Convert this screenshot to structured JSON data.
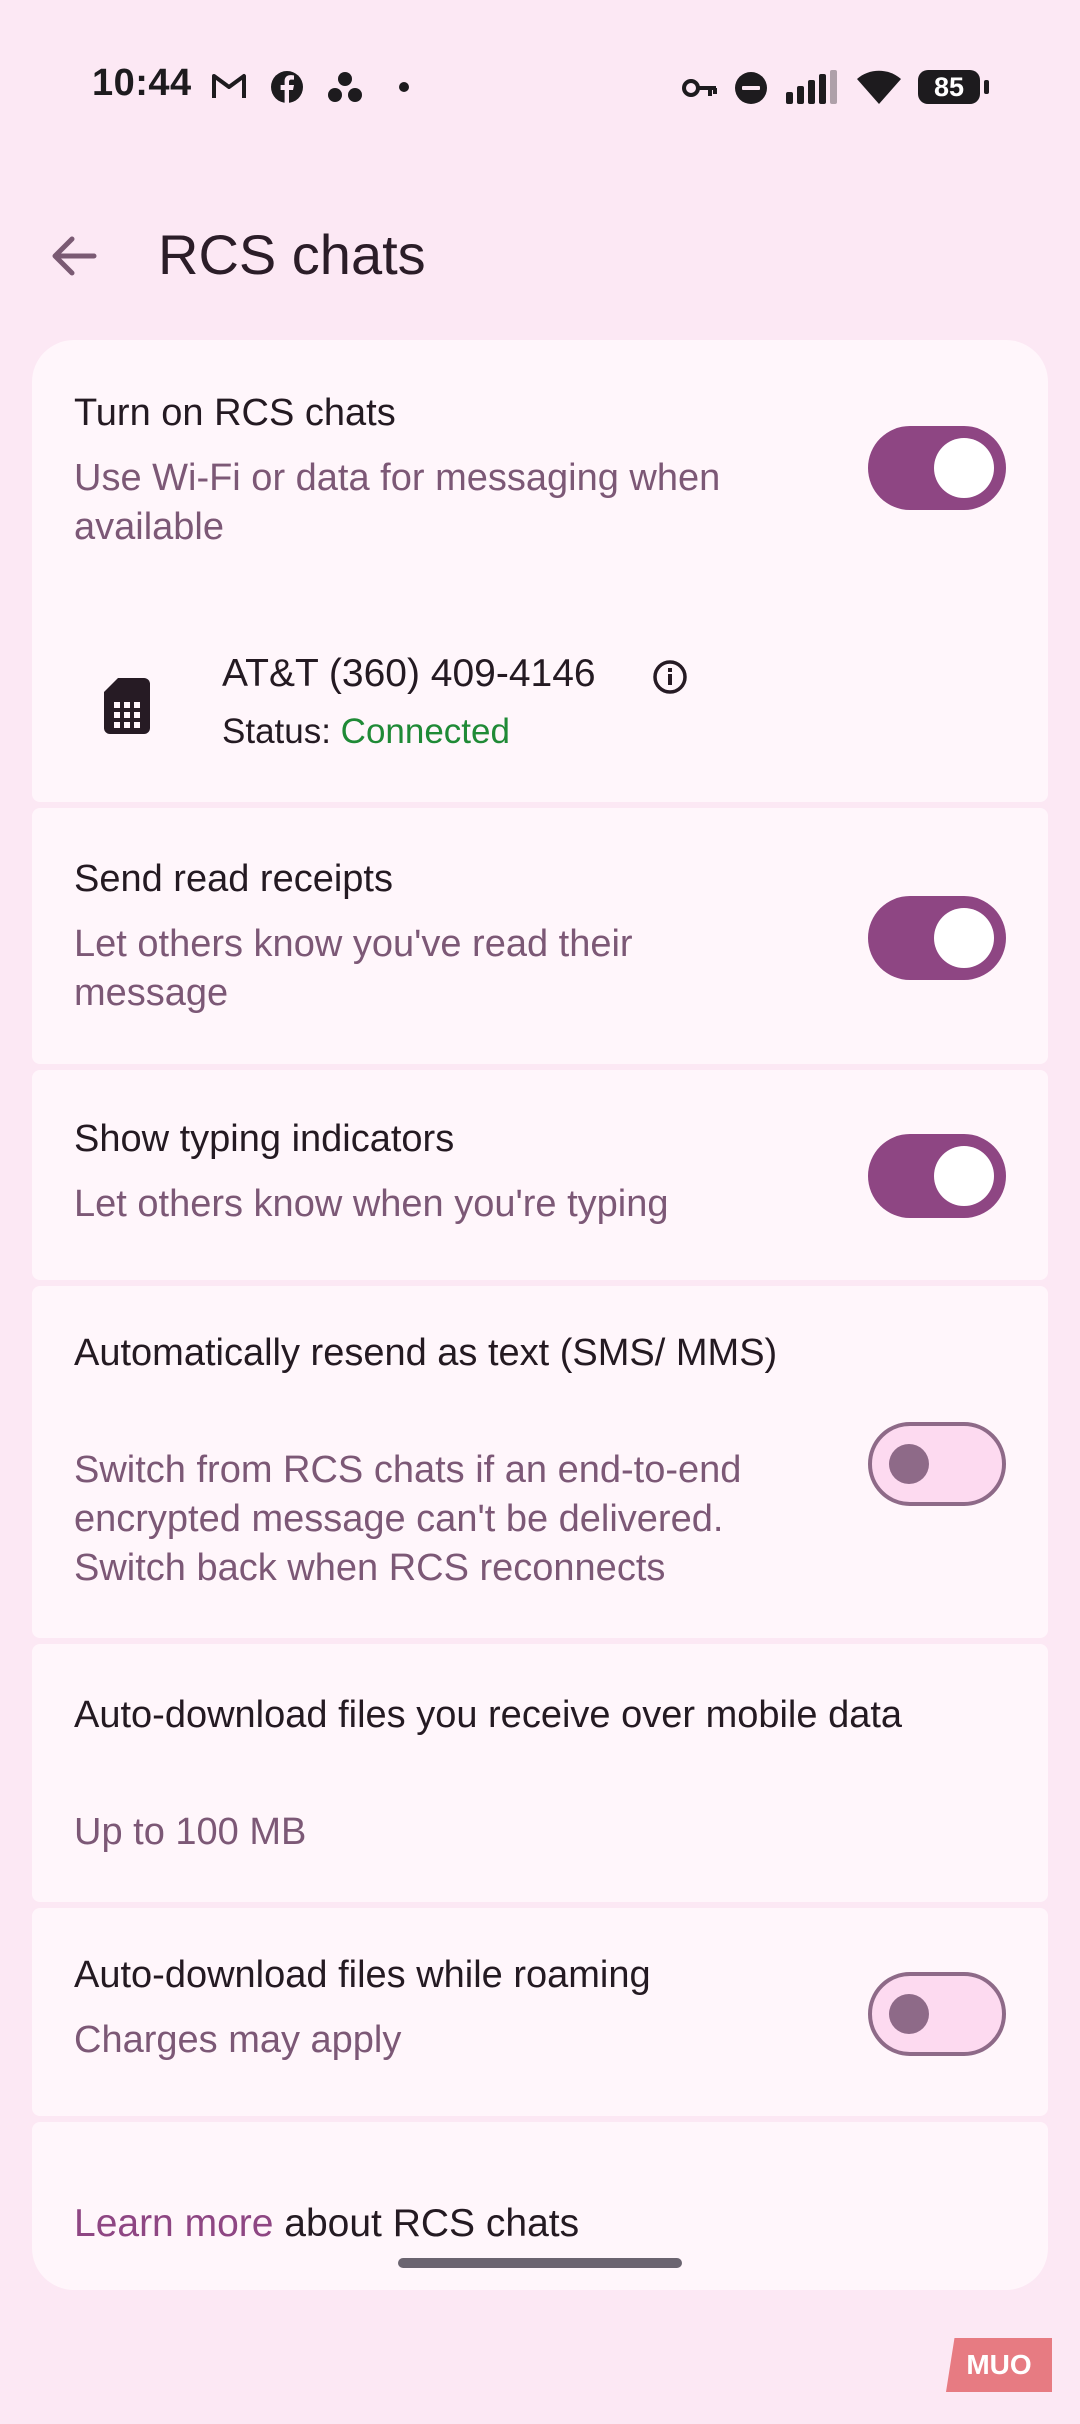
{
  "status_bar": {
    "time": "10:44",
    "battery": "85",
    "notification_icons": [
      "gmail-icon",
      "facebook-icon",
      "dots-icon",
      "dot-icon"
    ],
    "system_icons": [
      "vpn-key-icon",
      "dnd-icon",
      "signal-icon",
      "wifi-icon",
      "battery-icon"
    ]
  },
  "app_bar": {
    "title": "RCS chats",
    "back_icon": "arrow-back-icon"
  },
  "settings": {
    "rcs": {
      "title": "Turn on RCS chats",
      "subtitle": "Use Wi-Fi or data for messaging when available",
      "enabled": true
    },
    "sim": {
      "name": "AT&T (360) 409-4146",
      "status_label": "Status: ",
      "status_value": "Connected",
      "icon": "sim-card-icon",
      "info_icon": "info-icon"
    },
    "read_receipts": {
      "title": "Send read receipts",
      "subtitle": "Let others know you've read their message",
      "enabled": true
    },
    "typing": {
      "title": "Show typing indicators",
      "subtitle": "Let others know when you're typing",
      "enabled": true
    },
    "resend": {
      "title": "Automatically resend as text (SMS/ MMS)",
      "subtitle": "Switch from RCS chats if an end-to-end encrypted message can't be delivered. Switch back when RCS reconnects",
      "enabled": false
    },
    "auto_download": {
      "title": "Auto-download files you receive over mobile data",
      "subtitle": "Up to 100 MB"
    },
    "roaming": {
      "title": "Auto-download files while roaming",
      "subtitle": "Charges may apply",
      "enabled": false
    },
    "learn_more": {
      "link": "Learn more",
      "rest": " about RCS chats"
    }
  },
  "watermark": "MUO",
  "colors": {
    "background": "#fce8f4",
    "card": "#fff6fb",
    "accent": "#8e4683",
    "connected": "#1f8a36"
  }
}
